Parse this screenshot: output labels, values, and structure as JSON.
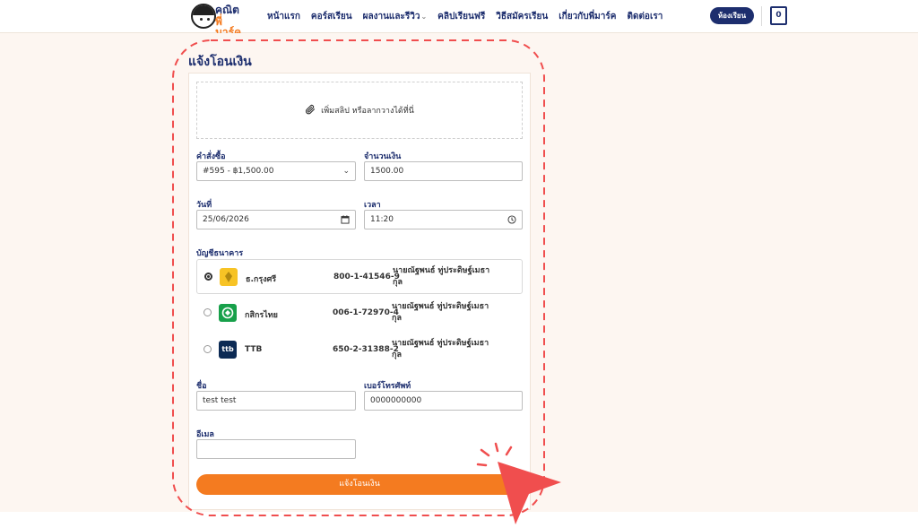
{
  "header": {
    "logo_line1": "คณิต",
    "logo_line2": "พี่มาร์ค",
    "nav": [
      {
        "label": "หน้าแรก"
      },
      {
        "label": "คอร์สเรียน"
      },
      {
        "label": "ผลงานและรีวิว"
      },
      {
        "label": "คลิปเรียนฟรี"
      },
      {
        "label": "วิธีสมัครเรียน"
      },
      {
        "label": "เกี่ยวกับพี่มาร์ค"
      },
      {
        "label": "ติดต่อเรา"
      }
    ],
    "cta_label": "ห้องเรียน",
    "cart_count": "0"
  },
  "form": {
    "title": "แจ้งโอนเงิน",
    "dropzone_label": "เพิ่มสลิป หรือลากวางได้ที่นี่",
    "order_label": "คำสั่งซื้อ",
    "order_value": "#595 - ฿1,500.00",
    "amount_label": "จำนวนเงิน",
    "amount_value": "1500.00",
    "date_label": "วันที่",
    "date_value": "25/06/2026",
    "time_label": "เวลา",
    "time_value": "11:20",
    "bank_section_label": "บัญชีธนาคาร",
    "banks": [
      {
        "name": "ธ.กรุงศรี",
        "account": "800-1-41546-9",
        "holder": "นายณัฐพนธ์ ทู่ประดิษฐ์เมธากุล",
        "color": "#f7c325",
        "icon": "krungsri-logo",
        "selected": "true"
      },
      {
        "name": "กสิกรไทย",
        "account": "006-1-72970-4",
        "holder": "นายณัฐพนธ์ ทู่ประดิษฐ์เมธากุล",
        "color": "#17a04a",
        "icon": "kbank-logo",
        "selected": "false"
      },
      {
        "name": "TTB",
        "account": "650-2-31388-2",
        "holder": "นายณัฐพนธ์ ทู่ประดิษฐ์เมธากุล",
        "color": "#0c2a54",
        "icon": "ttb-logo",
        "logo_text": "ttb",
        "selected": "false"
      }
    ],
    "name_label": "ชื่อ",
    "name_value": "test test",
    "phone_label": "เบอร์โทรศัพท์",
    "phone_value": "0000000000",
    "email_label": "อีเมล",
    "email_value": "",
    "submit_label": "แจ้งโอนเงิน"
  },
  "colors": {
    "brand_navy": "#1d2e6e",
    "brand_orange": "#f47b20",
    "annotation_red": "#f04e4e",
    "page_bg": "#fdf6f1"
  },
  "icons": {
    "dropzone": "paperclip-icon",
    "order_select": "chevron-down-icon",
    "date_picker": "calendar-icon",
    "time_picker": "clock-icon"
  }
}
